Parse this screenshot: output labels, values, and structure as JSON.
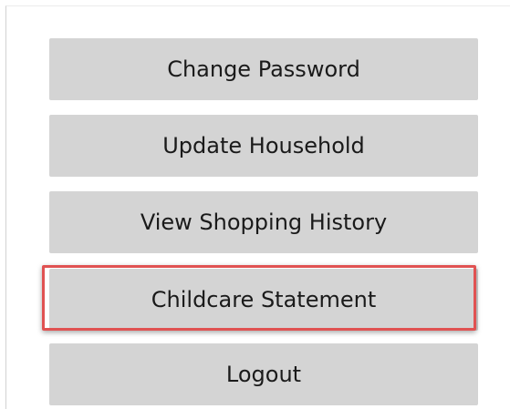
{
  "menu": {
    "items": [
      {
        "label": "Change Password"
      },
      {
        "label": "Update Household"
      },
      {
        "label": "View Shopping History"
      },
      {
        "label": "Childcare Statement",
        "highlighted": true
      },
      {
        "label": "Logout"
      }
    ]
  },
  "colors": {
    "button_bg": "#d4d4d4",
    "highlight_border": "#e05252",
    "text": "#1a1a1a"
  }
}
